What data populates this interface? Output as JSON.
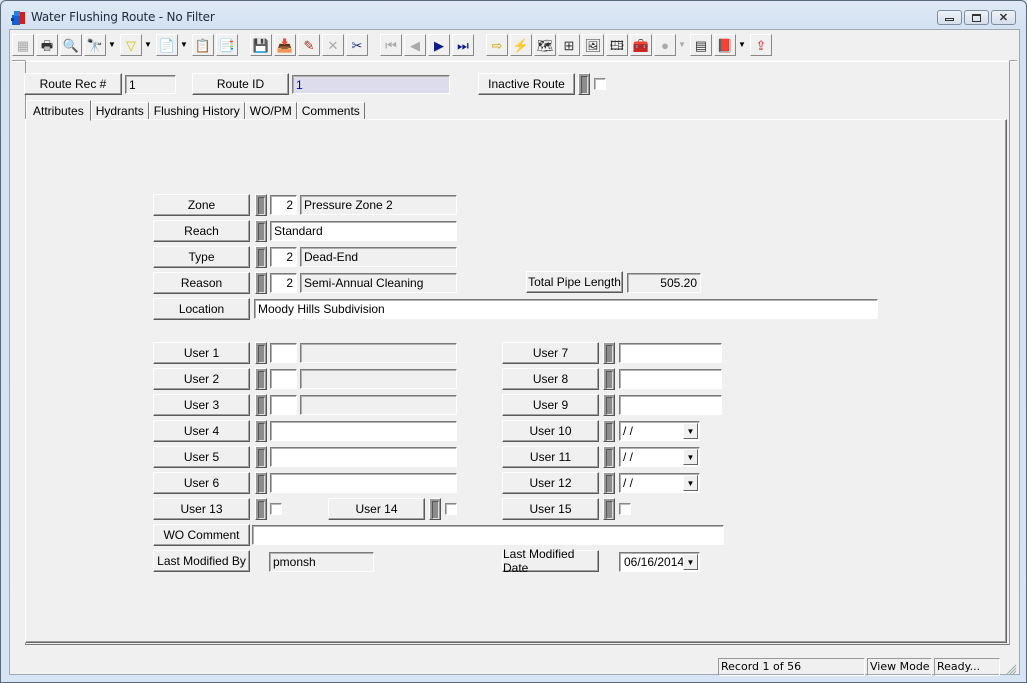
{
  "window": {
    "title": "Water Flushing Route - No Filter",
    "controls": {
      "minimize": "minimize",
      "maximize": "maximize",
      "close": "close"
    }
  },
  "toolbar": {
    "buttons": [
      {
        "name": "form-view-icon",
        "glyph": "▦",
        "enabled": false
      },
      {
        "name": "print-icon",
        "glyph": "🖶",
        "enabled": true
      },
      {
        "name": "print-preview-icon",
        "glyph": "🔍",
        "enabled": true
      },
      {
        "name": "query-icon",
        "glyph": "🔭",
        "enabled": true,
        "dropdown": true
      },
      {
        "name": "filter-icon",
        "glyph": "▽",
        "enabled": true,
        "dropdown": true
      },
      {
        "name": "report-icon",
        "glyph": "📄",
        "enabled": true,
        "dropdown": true
      },
      {
        "name": "properties-icon",
        "glyph": "📋",
        "enabled": false
      },
      {
        "name": "export-icon",
        "glyph": "📑",
        "enabled": true
      },
      {
        "name": "save-icon",
        "glyph": "💾",
        "enabled": false
      },
      {
        "name": "add-record-icon",
        "glyph": "📥",
        "enabled": true
      },
      {
        "name": "edit-icon",
        "glyph": "✎",
        "enabled": true
      },
      {
        "name": "delete-icon",
        "glyph": "✕",
        "enabled": false
      },
      {
        "name": "cut-icon",
        "glyph": "✂",
        "enabled": true
      },
      {
        "name": "first-record-icon",
        "glyph": "⏮",
        "enabled": false
      },
      {
        "name": "previous-record-icon",
        "glyph": "◀",
        "enabled": false
      },
      {
        "name": "next-record-icon",
        "glyph": "▶",
        "enabled": true
      },
      {
        "name": "last-record-icon",
        "glyph": "⏭",
        "enabled": true
      },
      {
        "name": "goto-icon",
        "glyph": "⇨",
        "enabled": true
      },
      {
        "name": "lightning-icon",
        "glyph": "⚡",
        "enabled": true
      },
      {
        "name": "map-icon",
        "glyph": "🗺",
        "enabled": true
      },
      {
        "name": "hierarchy-icon",
        "glyph": "⊞",
        "enabled": true
      },
      {
        "name": "workorder-icon",
        "glyph": "🖼",
        "enabled": true
      },
      {
        "name": "inspection-icon",
        "glyph": "🖽",
        "enabled": true
      },
      {
        "name": "toolbox-icon",
        "glyph": "🧰",
        "enabled": true
      },
      {
        "name": "gis-globe-icon",
        "glyph": "●",
        "enabled": false,
        "dropdown": true
      },
      {
        "name": "calculator-icon",
        "glyph": "▤",
        "enabled": true
      },
      {
        "name": "help-book-icon",
        "glyph": "📕",
        "enabled": true,
        "dropdown": true
      },
      {
        "name": "exit-icon",
        "glyph": "⇪",
        "enabled": true
      }
    ]
  },
  "header": {
    "route_rec_label": "Route Rec #",
    "route_rec_value": "1",
    "route_id_label": "Route ID",
    "route_id_value": "1",
    "inactive_label": "Inactive Route",
    "inactive_checked": false
  },
  "tabs": [
    {
      "label": "Attributes",
      "active": true
    },
    {
      "label": "Hydrants",
      "active": false
    },
    {
      "label": "Flushing History",
      "active": false
    },
    {
      "label": "WO/PM",
      "active": false
    },
    {
      "label": "Comments",
      "active": false
    }
  ],
  "attributes": {
    "zone": {
      "label": "Zone",
      "code": "2",
      "desc": "Pressure Zone 2"
    },
    "reach": {
      "label": "Reach",
      "value": "Standard"
    },
    "type": {
      "label": "Type",
      "code": "2",
      "desc": "Dead-End"
    },
    "reason": {
      "label": "Reason",
      "code": "2",
      "desc": "Semi-Annual Cleaning"
    },
    "total_pipe_length": {
      "label": "Total Pipe Length",
      "value": "505.20"
    },
    "location": {
      "label": "Location",
      "value": "Moody Hills Subdivision"
    },
    "user1": {
      "label": "User 1",
      "code": "",
      "desc": ""
    },
    "user2": {
      "label": "User 2",
      "code": "",
      "desc": ""
    },
    "user3": {
      "label": "User 3",
      "code": "",
      "desc": ""
    },
    "user4": {
      "label": "User 4",
      "value": ""
    },
    "user5": {
      "label": "User 5",
      "value": ""
    },
    "user6": {
      "label": "User 6",
      "value": ""
    },
    "user7": {
      "label": "User 7",
      "value": ""
    },
    "user8": {
      "label": "User 8",
      "value": ""
    },
    "user9": {
      "label": "User 9",
      "value": ""
    },
    "user10": {
      "label": "User 10",
      "value": " /  /"
    },
    "user11": {
      "label": "User 11",
      "value": " /  /"
    },
    "user12": {
      "label": "User 12",
      "value": " /  /"
    },
    "user13": {
      "label": "User 13",
      "checked": false
    },
    "user14": {
      "label": "User 14",
      "checked": false
    },
    "user15": {
      "label": "User 15",
      "checked": false
    },
    "wo_comment": {
      "label": "WO Comment",
      "value": ""
    },
    "last_modified_by": {
      "label": "Last Modified By",
      "value": "pmonsh"
    },
    "last_modified_date": {
      "label": "Last Modified Date",
      "value": "06/16/2014"
    }
  },
  "statusbar": {
    "record": "Record 1 of 56",
    "mode": "View Mode",
    "status": "Ready..."
  }
}
